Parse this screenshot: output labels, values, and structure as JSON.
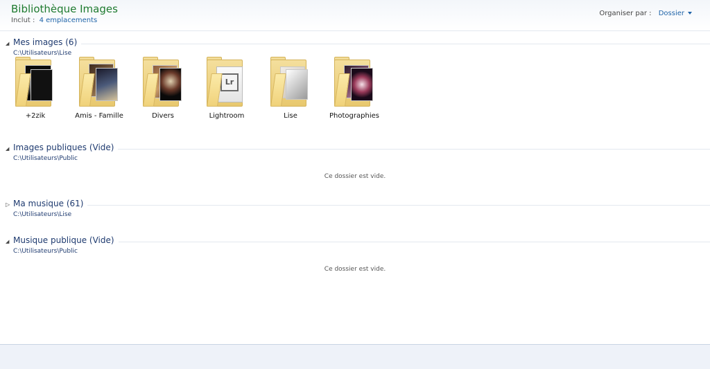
{
  "header": {
    "title": "Bibliothèque Images",
    "includes_label": "Inclut :",
    "includes_link": "4 emplacements",
    "arrange_label": "Organiser par :",
    "arrange_value": "Dossier"
  },
  "groups": [
    {
      "title": "Mes images (6)",
      "path": "C:\\Utilisateurs\\Lise",
      "expanded": true,
      "folders": [
        {
          "label": "+2zik"
        },
        {
          "label": "Amis - Famille"
        },
        {
          "label": "Divers"
        },
        {
          "label": "Lightroom",
          "badge": "Lr"
        },
        {
          "label": "Lise"
        },
        {
          "label": "Photographies"
        }
      ]
    },
    {
      "title": "Images publiques (Vide)",
      "path": "C:\\Utilisateurs\\Public",
      "expanded": true,
      "empty_text": "Ce dossier est vide."
    },
    {
      "title": "Ma musique (61)",
      "path": "C:\\Utilisateurs\\Lise",
      "expanded": false
    },
    {
      "title": "Musique publique (Vide)",
      "path": "C:\\Utilisateurs\\Public",
      "expanded": true,
      "empty_text": "Ce dossier est vide."
    }
  ],
  "icons": {
    "expanded": "triangle-down-icon",
    "collapsed": "triangle-right-icon",
    "folder": "folder-icon"
  },
  "colors": {
    "title": "#1e7a2f",
    "link": "#1f64a8",
    "group_title": "#1e3a6f"
  }
}
